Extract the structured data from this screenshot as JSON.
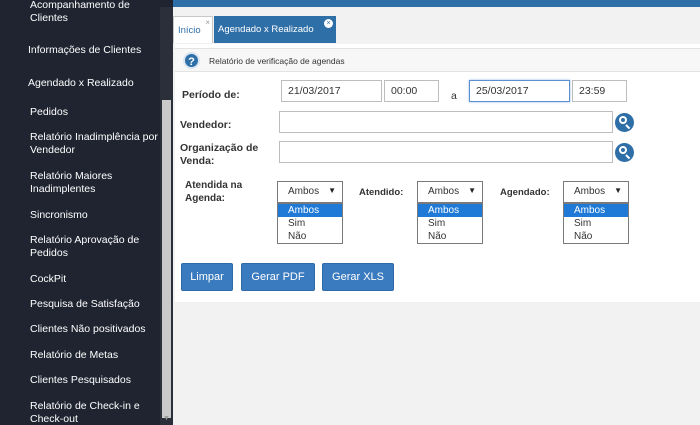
{
  "sidebar": {
    "items": [
      {
        "label": "Acompanhamento de Clientes"
      },
      {
        "label": "Informações de Clientes"
      },
      {
        "label": "Agendado x Realizado"
      },
      {
        "label": "Pedidos"
      },
      {
        "label": "Relatório Inadimplência por Vendedor"
      },
      {
        "label": "Relatório Maiores Inadimplentes"
      },
      {
        "label": "Sincronismo"
      },
      {
        "label": "Relatório Aprovação de Pedidos"
      },
      {
        "label": "CockPit"
      },
      {
        "label": "Pesquisa de Satisfação"
      },
      {
        "label": "Clientes Não positivados"
      },
      {
        "label": "Relatório de Metas"
      },
      {
        "label": "Clientes Pesquisados"
      },
      {
        "label": "Relatório de Check-in e Check-out"
      }
    ]
  },
  "tabs": {
    "inicio": "Início",
    "agendado": "Agendado x Realizado"
  },
  "header": {
    "title": "Relatório de verificação de agendas"
  },
  "form": {
    "periodo_label": "Período de:",
    "date_from": "21/03/2017",
    "time_from": "00:00",
    "a_label": "a",
    "date_to": "25/03/2017",
    "time_to": "23:59",
    "vendedor_label": "Vendedor:",
    "org_label": "Organização de Venda:",
    "atendida_label": "Atendida na Agenda:",
    "atendido_label": "Atendido:",
    "agendado_label": "Agendado:",
    "select_value": "Ambos",
    "options": [
      "Ambos",
      "Sim",
      "Não"
    ]
  },
  "buttons": {
    "limpar": "Limpar",
    "gerar_pdf": "Gerar PDF",
    "gerar_xls": "Gerar XLS"
  },
  "colors": {
    "accent": "#2f6fa8",
    "sidebar_bg": "#1f2430",
    "selected_option": "#1e7ad6"
  }
}
